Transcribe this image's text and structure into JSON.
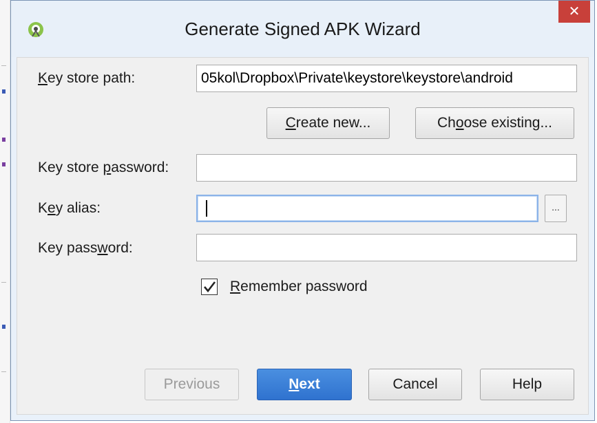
{
  "dialog": {
    "title": "Generate Signed APK Wizard",
    "close_glyph": "✕"
  },
  "form": {
    "key_store_path": {
      "label_u": "K",
      "label_rest": "ey store path:",
      "value": "05kol\\Dropbox\\Private\\keystore\\keystore\\android"
    },
    "create_new": {
      "label_u": "C",
      "label_rest": "reate new..."
    },
    "choose_existing": {
      "label_pre": "Ch",
      "label_u": "o",
      "label_rest": "ose existing..."
    },
    "key_store_password": {
      "label_pre": "Key store ",
      "label_u": "p",
      "label_rest": "assword:",
      "value": ""
    },
    "key_alias": {
      "label_pre": "K",
      "label_u": "e",
      "label_rest": "y alias:",
      "value": "",
      "browse_glyph": "..."
    },
    "key_password": {
      "label_pre": "Key pass",
      "label_u": "w",
      "label_rest": "ord:",
      "value": ""
    },
    "remember_password": {
      "label_u": "R",
      "label_rest": "emember password",
      "checked": true
    }
  },
  "buttons": {
    "previous": "Previous",
    "next_u": "N",
    "next_rest": "ext",
    "cancel": "Cancel",
    "help": "Help"
  },
  "colors": {
    "primary": "#2f72cf",
    "close": "#c8403a",
    "android_green": "#8bc34a"
  },
  "icons": {
    "app": "android-studio-icon",
    "close": "close-icon",
    "check": "checkmark-icon"
  }
}
